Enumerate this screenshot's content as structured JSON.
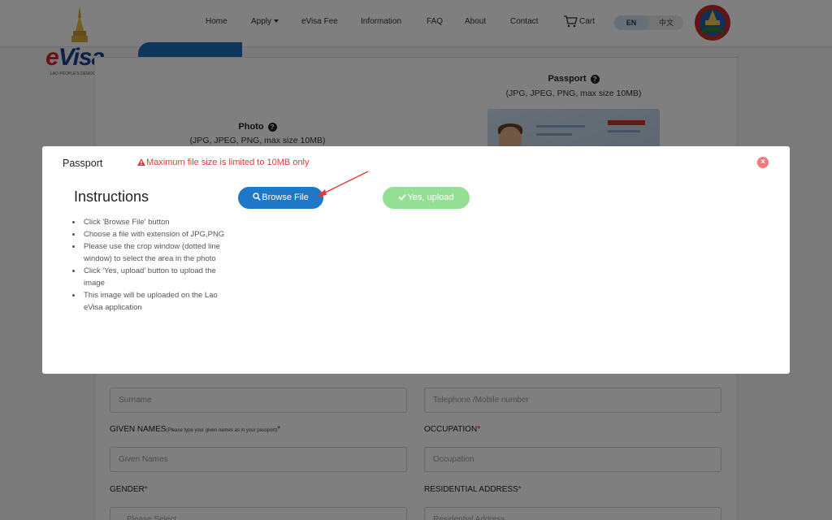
{
  "header": {
    "logo_text_e": "e",
    "logo_text_rest": "Visa",
    "logo_tagline": "LAO PEOPLE'S DEMOCRATIC REPUBLIC",
    "nav": {
      "home": "Home",
      "apply": "Apply",
      "evisa_fee": "eVisa Fee",
      "information": "Information",
      "faq": "FAQ",
      "about": "About",
      "contact": "Contact",
      "cart": "Cart"
    },
    "lang_en": "EN",
    "lang_zh": "中文"
  },
  "upload_section": {
    "passport_title": "Passport",
    "passport_formats": "(JPG, JPEG, PNG, max size 10MB)",
    "photo_title": "Photo",
    "photo_formats": "(JPG, JPEG, PNG, max size 10MB)",
    "help_icon": "?"
  },
  "form": {
    "surname_placeholder": "Surname",
    "phone_placeholder": "Telephone /Mobile number",
    "given_names_label": "GIVEN NAMES",
    "given_names_hint": "(Please type your given names as in your passport)",
    "given_names_placeholder": "Given Names",
    "occupation_label": "OCCUPATION",
    "occupation_placeholder": "Occupation",
    "gender_label": "GENDER",
    "address_label": "RESIDENTIAL ADDRESS",
    "gender_placeholder": "Please Select",
    "address_placeholder": "Residential Address",
    "required_mark": "*"
  },
  "modal": {
    "title": "Passport",
    "warning": "Maximum file size is limited to 10MB only",
    "close_glyph": "×",
    "instructions_title": "Instructions",
    "instructions": [
      "Click 'Browse File' button",
      "Choose a file with extension of JPG,PNG",
      "Please use the crop window (dotted line window) to select the area in the photo",
      "Click 'Yes, upload' button to upload the image",
      "This image will be uploaded on the Lao eVisa application"
    ],
    "browse_label": "Browse File",
    "upload_label": "Yes, upload"
  },
  "colors": {
    "primary_blue": "#1f77c7",
    "success_green": "#93df93",
    "warning_red": "#e53935"
  }
}
